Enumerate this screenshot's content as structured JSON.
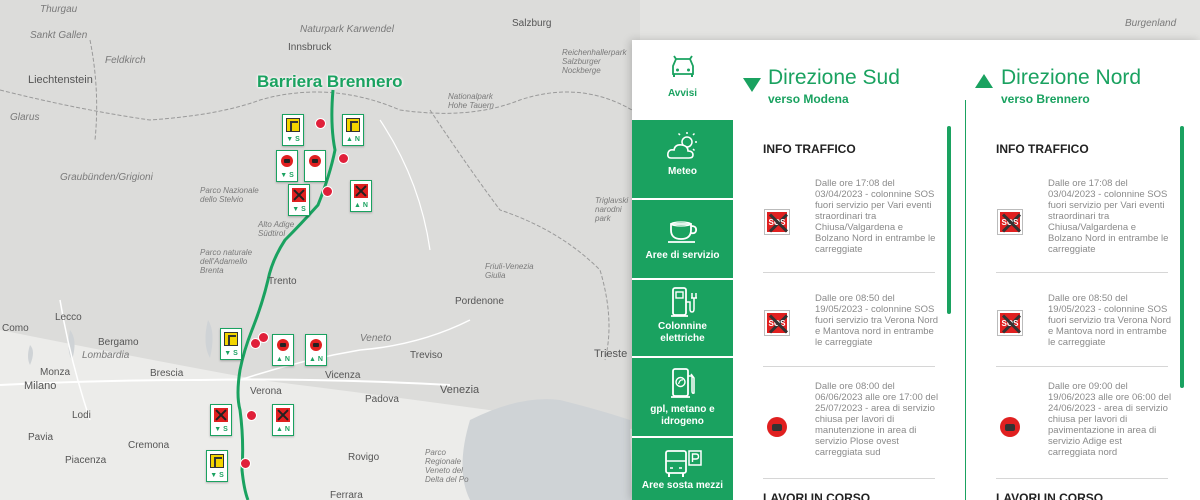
{
  "map": {
    "title": "Barriera Brennero",
    "places": [
      "Thurgau",
      "Sankt Gallen",
      "Feldkirch",
      "Liechtenstein",
      "Glarus",
      "Innsbruck",
      "Naturpark Karwendel",
      "Salzburg",
      "Reichenhallerpark Salzburger Nockberge",
      "Burgenland",
      "Nationalpark Hohe Tauern",
      "Graubünden/Grigioni",
      "Parco Nazionale dello Stelvio",
      "Alto Adige Südtirol",
      "Parco naturale dell'Adamello Brenta",
      "Trento",
      "Triglavski narodni park",
      "Friuli-Venezia Giulia",
      "Pordenone",
      "Lecco",
      "Como",
      "Bergamo",
      "Lombardia",
      "Brescia",
      "Verona",
      "Veneto",
      "Treviso",
      "Trieste",
      "Venezia",
      "Padova",
      "Vicenza",
      "Milano",
      "Monza",
      "Lodi",
      "Pavia",
      "Cremona",
      "Piacenza",
      "Rovigo",
      "Parco Regionale Veneto del Delta del Po",
      "Ferrara"
    ],
    "markers": [
      "▲ N",
      "▼ S",
      "▼ S",
      "▲ N",
      "▼ S",
      "▲ N",
      "▲ N",
      "▼ S",
      "▲ N",
      "▼ S"
    ]
  },
  "categories": [
    {
      "label": "Avvisi",
      "icon": "car-icon"
    },
    {
      "label": "Meteo",
      "icon": "weather-icon"
    },
    {
      "label": "Aree di servizio",
      "icon": "coffee-cup-icon"
    },
    {
      "label": "Colonnine elettriche",
      "icon": "ev-charger-icon"
    },
    {
      "label": "gpl, metano e idrogeno",
      "icon": "fuel-pump-icon"
    },
    {
      "label": "Aree sosta mezzi",
      "icon": "truck-parking-icon"
    }
  ],
  "south": {
    "title": "Direzione Sud",
    "subtitle": "verso Modena",
    "section": "INFO TRAFFICO",
    "items": [
      "Dalle ore 17:08 del 03/04/2023 - colonnine SOS fuori servizio per Vari eventi straordinari tra Chiusa/Valgardena e Bolzano Nord in entrambe le carreggiate",
      "Dalle ore 08:50 del 19/05/2023 - colonnine SOS fuori servizio tra Verona Nord e Mantova nord in entrambe le carreggiate",
      "Dalle ore 08:00 del 06/06/2023 alle ore 17:00 del 25/07/2023 - area di servizio chiusa per lavori di manutenzione in area di servizio Plose ovest carreggiata sud"
    ],
    "next_section": "LAVORI IN CORSO"
  },
  "north": {
    "title": "Direzione Nord",
    "subtitle": "verso Brennero",
    "section": "INFO TRAFFICO",
    "items": [
      "Dalle ore 17:08 del 03/04/2023 - colonnine SOS fuori servizio per Vari eventi straordinari tra Chiusa/Valgardena e Bolzano Nord in entrambe le carreggiate",
      "Dalle ore 08:50 del 19/05/2023 - colonnine SOS fuori servizio tra Verona Nord e Mantova nord in entrambe le carreggiate",
      "Dalle ore 09:00 del 19/06/2023 alle ore 06:00 del 24/06/2023 - area di servizio chiusa per lavori di pavimentazione in area di servizio Adige est carreggiata nord"
    ],
    "next_section": "LAVORI IN CORSO"
  },
  "icon_labels": {
    "sos": "SOS"
  },
  "colors": {
    "accent": "#1aa260",
    "alert": "#e02020"
  }
}
